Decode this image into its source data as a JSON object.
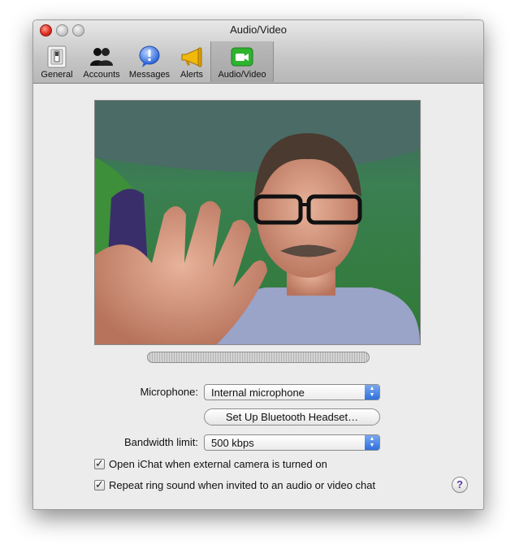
{
  "window": {
    "title": "Audio/Video"
  },
  "toolbar": {
    "items": [
      {
        "label": "General",
        "icon": "general-switch-icon"
      },
      {
        "label": "Accounts",
        "icon": "accounts-people-icon"
      },
      {
        "label": "Messages",
        "icon": "messages-bubble-icon"
      },
      {
        "label": "Alerts",
        "icon": "alerts-megaphone-icon"
      },
      {
        "label": "Audio/Video",
        "icon": "video-camera-icon",
        "selected": true
      }
    ]
  },
  "settings": {
    "microphone_label": "Microphone:",
    "microphone_value": "Internal microphone",
    "bluetooth_button": "Set Up Bluetooth Headset…",
    "bandwidth_label": "Bandwidth limit:",
    "bandwidth_value": "500 kbps",
    "checkbox1": {
      "label": "Open iChat when external camera is turned on",
      "checked": true
    },
    "checkbox2": {
      "label": "Repeat ring sound when invited to an audio or video chat",
      "checked": true
    },
    "help": "?"
  },
  "colors": {
    "accent": "#2f6fde",
    "close_button": "#e12d22",
    "facetime_green": "#2db52d"
  }
}
